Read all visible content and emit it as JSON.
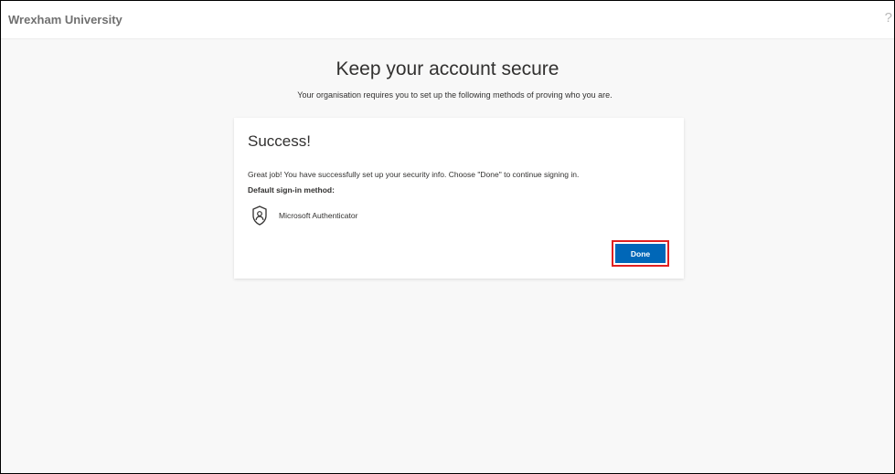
{
  "header": {
    "org_name": "Wrexham University",
    "help_glyph": "?"
  },
  "main": {
    "title": "Keep your account secure",
    "subtitle": "Your organisation requires you to set up the following methods of proving who you are."
  },
  "card": {
    "title": "Success!",
    "message": "Great job! You have successfully set up your security info. Choose \"Done\" to continue signing in.",
    "default_label": "Default sign-in method:",
    "method": {
      "icon": "authenticator-icon",
      "label": "Microsoft Authenticator"
    },
    "done_label": "Done"
  },
  "colors": {
    "primary_button": "#0067b8",
    "highlight_border": "#e02020"
  }
}
